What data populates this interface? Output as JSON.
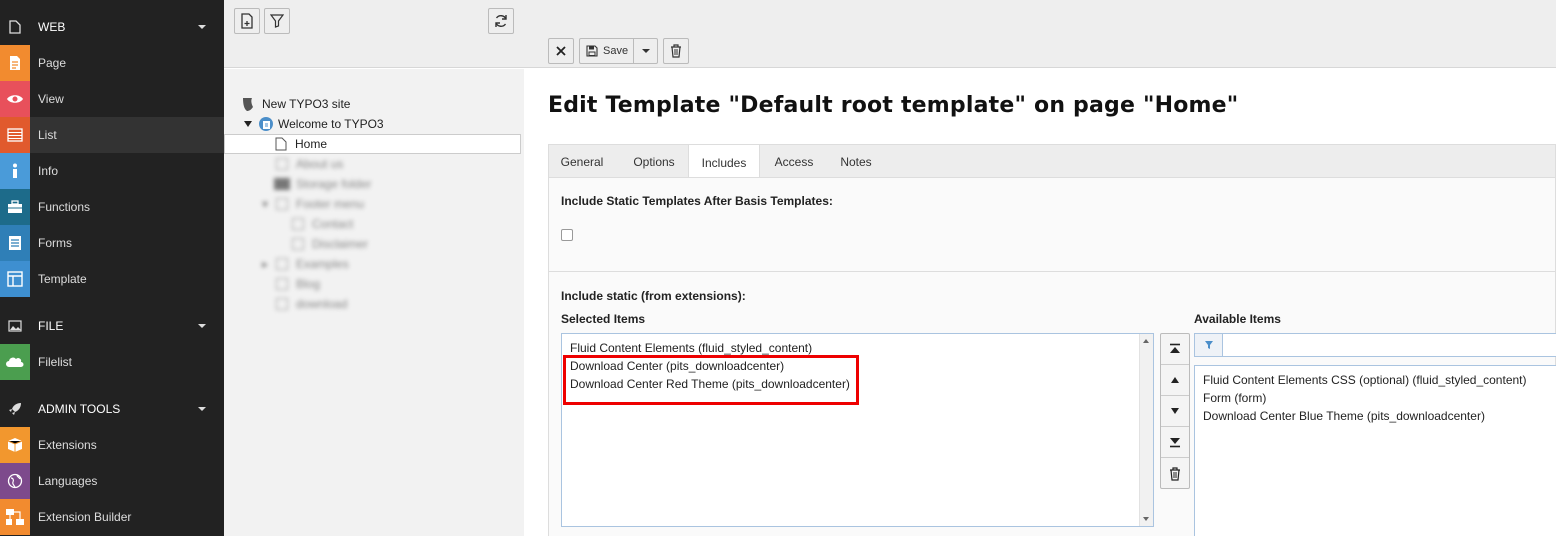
{
  "module_menu": {
    "groups": [
      {
        "label": "WEB",
        "icon": "page-icon"
      },
      {
        "label": "FILE",
        "icon": "image-icon"
      },
      {
        "label": "ADMIN TOOLS",
        "icon": "rocket-icon"
      }
    ],
    "items": [
      {
        "label": "Page",
        "color": "#f28b2f"
      },
      {
        "label": "View",
        "color": "#e8505b"
      },
      {
        "label": "List",
        "color": "#e15a2d"
      },
      {
        "label": "Info",
        "color": "#4a9bd9"
      },
      {
        "label": "Functions",
        "color": "#1d6b8a"
      },
      {
        "label": "Forms",
        "color": "#2f7fb7"
      },
      {
        "label": "Template",
        "color": "#3e8fd0"
      },
      {
        "label": "Filelist",
        "color": "#4b9e4f"
      },
      {
        "label": "Extensions",
        "color": "#f2972e"
      },
      {
        "label": "Languages",
        "color": "#7d4a8c"
      },
      {
        "label": "Extension Builder",
        "color": "#f28b2f"
      }
    ]
  },
  "tree": {
    "root": "New TYPO3 site",
    "site": "Welcome to TYPO3",
    "selected": "Home",
    "blurred": [
      "About us",
      "Storage folder",
      "Footer menu",
      "Contact",
      "Disclaimer",
      "Examples",
      "Blog",
      "download"
    ]
  },
  "docheader": {
    "save_label": "Save"
  },
  "page": {
    "title": "Edit Template \"Default root template\" on page \"Home\""
  },
  "tabs": [
    "General",
    "Options",
    "Includes",
    "Access",
    "Notes"
  ],
  "includes": {
    "after_basis_label": "Include Static Templates After Basis Templates:",
    "static_ext_label": "Include static (from extensions):",
    "selected_label": "Selected Items",
    "available_label": "Available Items",
    "selected_items": [
      "Fluid Content Elements (fluid_styled_content)",
      "Download Center (pits_downloadcenter)",
      "Download Center Red Theme (pits_downloadcenter)"
    ],
    "available_items": [
      "Fluid Content Elements CSS (optional) (fluid_styled_content)",
      "Form (form)",
      "Download Center Blue Theme (pits_downloadcenter)"
    ],
    "filter_placeholder": ""
  },
  "colors": {
    "highlight": "#e00000",
    "menu_bg": "#222222"
  }
}
